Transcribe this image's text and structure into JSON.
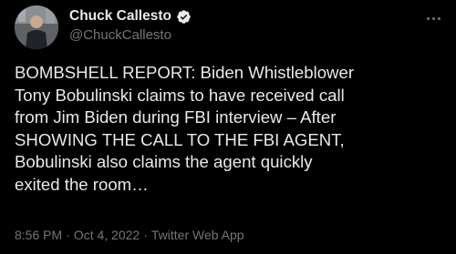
{
  "author": {
    "display_name": "Chuck Callesto",
    "handle": "@ChuckCallesto",
    "verified": true
  },
  "tweet": {
    "text": "BOMBSHELL REPORT: Biden Whistleblower\nTony Bobulinski claims to have received call\nfrom Jim Biden during FBI interview – After\nSHOWING THE CALL TO THE FBI AGENT,\nBobulinski also claims the agent quickly\nexited the room…",
    "time": "8:56 PM",
    "separator": "·",
    "date": "Oct 4, 2022",
    "source": "Twitter Web App"
  },
  "icons": {
    "verified": "verified-badge-icon",
    "more": "more-options-icon"
  },
  "colors": {
    "background": "#000000",
    "text": "#e7e9ea",
    "secondary": "#71767b",
    "verified": "#1d9bf0"
  }
}
